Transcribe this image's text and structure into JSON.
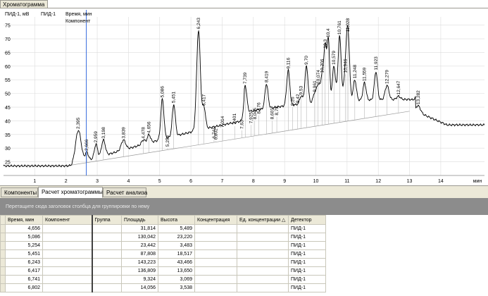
{
  "window": {
    "tab": "Хроматограмма"
  },
  "chart_header": {
    "signal_label": "ПИД-1, мВ",
    "channel_label": "ПИД-1",
    "time_label": "Время, мин",
    "component_label": "Компонент"
  },
  "chart_data": {
    "type": "line",
    "xlabel": "мин",
    "ylabel": "ПИД-1, мВ",
    "xlim": [
      0,
      15.4
    ],
    "ylim": [
      20,
      78
    ],
    "x_ticks": [
      "1",
      "2",
      "3",
      "4",
      "5",
      "6",
      "7",
      "8",
      "9",
      "10",
      "11",
      "12",
      "13",
      "14"
    ],
    "y_ticks": [
      "25",
      "30",
      "35",
      "40",
      "45",
      "50",
      "55",
      "60",
      "65",
      "70",
      "75"
    ],
    "cursor_x": 2.65,
    "baseline": [
      [
        2.0,
        23.5
      ],
      [
        13.0,
        43.5
      ]
    ],
    "trace_end": 38.5,
    "peaks": [
      {
        "t": 2.395,
        "h": 36.5,
        "w": 0.09,
        "label": "2,395"
      },
      {
        "t": 2.666,
        "h": 28.5,
        "w": 0.05,
        "label": "2,666"
      },
      {
        "t": 2.959,
        "h": 31.5,
        "w": 0.05,
        "label": "2,959"
      },
      {
        "t": 3.198,
        "h": 33.0,
        "w": 0.06,
        "label": "3,198"
      },
      {
        "t": 3.839,
        "h": 33.0,
        "w": 0.07,
        "label": "3,839"
      },
      {
        "t": 4.478,
        "h": 33.0,
        "w": 0.06,
        "label": "4,478"
      },
      {
        "t": 4.656,
        "h": 35.0,
        "w": 0.05,
        "label": "4,656"
      },
      {
        "t": 5.086,
        "h": 48.0,
        "w": 0.05,
        "label": "5,086"
      },
      {
        "t": 5.254,
        "h": 30.0,
        "w": 0.05,
        "label": "5,254"
      },
      {
        "t": 5.451,
        "h": 46.0,
        "w": 0.05,
        "label": "5,451"
      },
      {
        "t": 6.243,
        "h": 73.0,
        "w": 0.06,
        "label": "6,243"
      },
      {
        "t": 6.417,
        "h": 45.0,
        "w": 0.05,
        "label": "6,417"
      },
      {
        "t": 6.741,
        "h": 33.0,
        "w": 0.05,
        "label": "6,741"
      },
      {
        "t": 6.802,
        "h": 32.5,
        "w": 0.05,
        "label": "6,802"
      },
      {
        "t": 7.014,
        "h": 37.0,
        "w": 0.05,
        "label": "7,014"
      },
      {
        "t": 7.401,
        "h": 38.0,
        "w": 0.05,
        "label": "7,401"
      },
      {
        "t": 7.63,
        "h": 36.5,
        "w": 0.05,
        "label": "7,63"
      },
      {
        "t": 7.739,
        "h": 53.0,
        "w": 0.05,
        "label": "7,739"
      },
      {
        "t": 7.925,
        "h": 38.5,
        "w": 0.05,
        "label": "7,925"
      },
      {
        "t": 8.045,
        "h": 40.0,
        "w": 0.05,
        "label": "8,045"
      },
      {
        "t": 8.176,
        "h": 42.0,
        "w": 0.05,
        "label": "8,176"
      },
      {
        "t": 8.419,
        "h": 53.5,
        "w": 0.05,
        "label": "8,419"
      },
      {
        "t": 8.601,
        "h": 40.0,
        "w": 0.05,
        "label": "8,601"
      },
      {
        "t": 8.75,
        "h": 41.5,
        "w": 0.05,
        "label": "8,75"
      },
      {
        "t": 9.116,
        "h": 58.5,
        "w": 0.05,
        "label": "9,116"
      },
      {
        "t": 9.26,
        "h": 45.0,
        "w": 0.05,
        "label": "9,26"
      },
      {
        "t": 9.42,
        "h": 46.0,
        "w": 0.05,
        "label": "9,42"
      },
      {
        "t": 9.53,
        "h": 49.0,
        "w": 0.05,
        "label": "9,53"
      },
      {
        "t": 9.7,
        "h": 60.0,
        "w": 0.05,
        "label": "9,70"
      },
      {
        "t": 9.961,
        "h": 50.0,
        "w": 0.05,
        "label": "9,961"
      },
      {
        "t": 10.074,
        "h": 53.0,
        "w": 0.05,
        "label": "10,074"
      },
      {
        "t": 10.206,
        "h": 57.0,
        "w": 0.05,
        "label": "10,206"
      },
      {
        "t": 10.3,
        "h": 66.0,
        "w": 0.04,
        "label": "10,3"
      },
      {
        "t": 10.4,
        "h": 70.0,
        "w": 0.04,
        "label": "10,4"
      },
      {
        "t": 10.579,
        "h": 60.0,
        "w": 0.05,
        "label": "10,579"
      },
      {
        "t": 10.761,
        "h": 71.0,
        "w": 0.05,
        "label": "10,761"
      },
      {
        "t": 10.946,
        "h": 57.0,
        "w": 0.05,
        "label": "10,946"
      },
      {
        "t": 11.028,
        "h": 72.0,
        "w": 0.05,
        "label": "11,028"
      },
      {
        "t": 11.248,
        "h": 55.0,
        "w": 0.05,
        "label": "11,248"
      },
      {
        "t": 11.559,
        "h": 54.0,
        "w": 0.05,
        "label": "11,559"
      },
      {
        "t": 11.923,
        "h": 58.0,
        "w": 0.05,
        "label": "11,923"
      },
      {
        "t": 12.279,
        "h": 53.0,
        "w": 0.06,
        "label": "12,279"
      },
      {
        "t": 12.647,
        "h": 49.0,
        "w": 0.06,
        "label": "12,647"
      },
      {
        "t": 13.282,
        "h": 45.5,
        "w": 0.07,
        "label": "13,282"
      }
    ]
  },
  "bottom_tabs": [
    "Компоненты",
    "Расчет хроматограммы",
    "Расчет анализа"
  ],
  "group_hint": "Перетащите сюда заголовок столбца для группировки по нему",
  "table": {
    "columns": [
      "Время, мин",
      "Компонент",
      "Группа",
      "Площадь",
      "Высота",
      "Концентрация",
      "Ед. концентрации",
      "Детектор"
    ],
    "rows": [
      [
        "4,656",
        "",
        "",
        "31,814",
        "5,489",
        "",
        "",
        "ПИД-1"
      ],
      [
        "5,086",
        "",
        "",
        "130,042",
        "23,220",
        "",
        "",
        "ПИД-1"
      ],
      [
        "5,254",
        "",
        "",
        "23,442",
        "3,483",
        "",
        "",
        "ПИД-1"
      ],
      [
        "5,451",
        "",
        "",
        "87,808",
        "18,517",
        "",
        "",
        "ПИД-1"
      ],
      [
        "6,243",
        "",
        "",
        "143,223",
        "43,466",
        "",
        "",
        "ПИД-1"
      ],
      [
        "6,417",
        "",
        "",
        "136,809",
        "13,650",
        "",
        "",
        "ПИД-1"
      ],
      [
        "6,741",
        "",
        "",
        "9,324",
        "3,069",
        "",
        "",
        "ПИД-1"
      ],
      [
        "6,802",
        "",
        "",
        "14,056",
        "3,538",
        "",
        "",
        "ПИД-1"
      ]
    ]
  }
}
